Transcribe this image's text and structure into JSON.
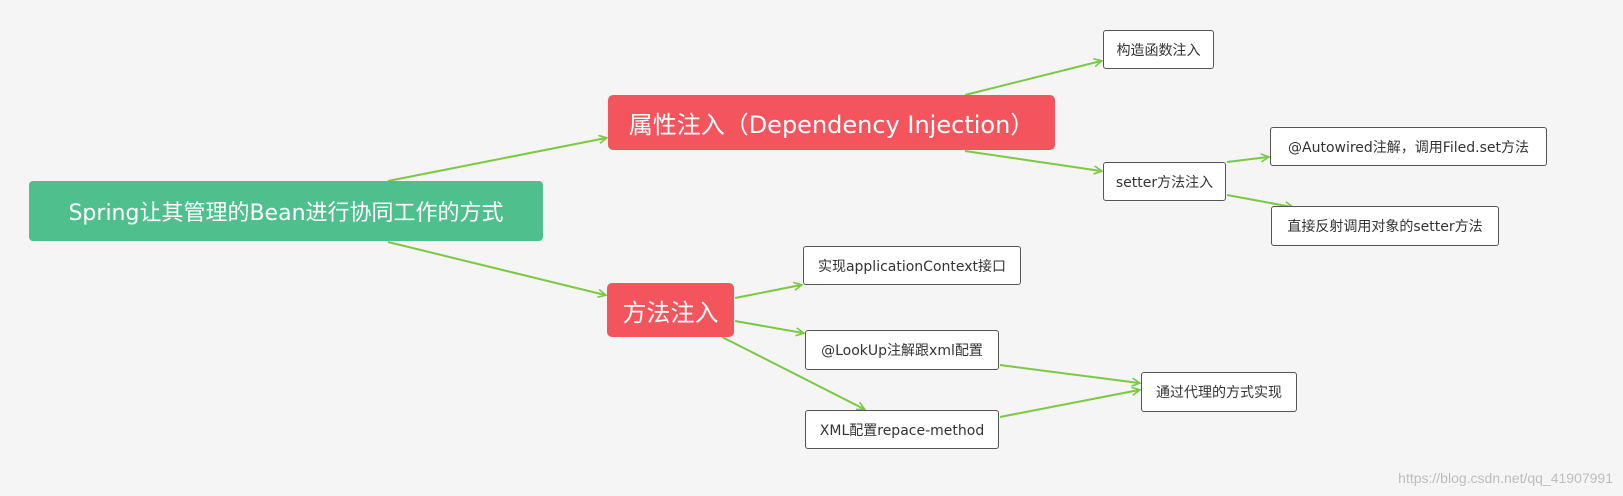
{
  "diagram": {
    "edge_color": "#7ac943",
    "root": {
      "label": "Spring让其管理的Bean进行协同工作的方式"
    },
    "branches": [
      {
        "label": "属性注入（Dependency Injection）"
      },
      {
        "label": "方法注入"
      }
    ],
    "leaves": {
      "constructor": "构造函数注入",
      "setter": "setter方法注入",
      "autowired": "@Autowired注解，调用Filed.set方法",
      "reflect": "直接反射调用对象的setter方法",
      "appctx": "实现applicationContext接口",
      "lookup": "@LookUp注解跟xml配置",
      "xml": "XML配置repace-method",
      "proxy": "通过代理的方式实现"
    }
  },
  "watermark": "https://blog.csdn.net/qq_41907991"
}
